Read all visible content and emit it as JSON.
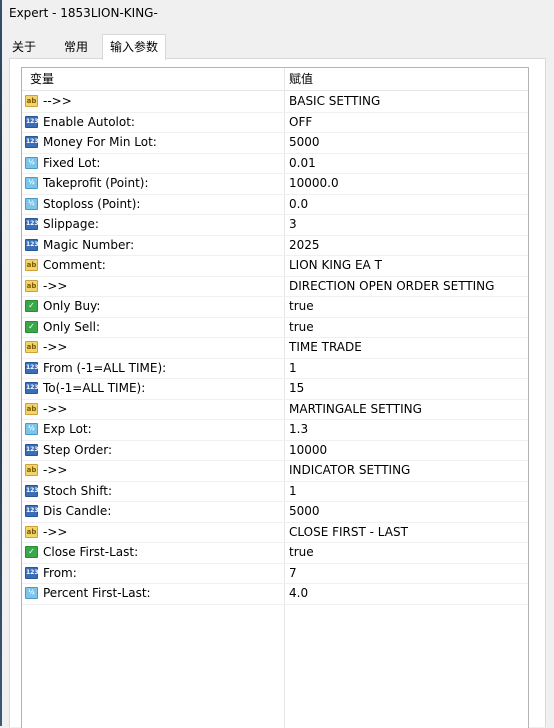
{
  "window": {
    "title": "Expert - 1853LION-KING-"
  },
  "tabs": [
    {
      "label": "关于"
    },
    {
      "label": "常用"
    },
    {
      "label": "输入参数"
    }
  ],
  "table": {
    "headers": {
      "variable": "变量",
      "value": "赋值"
    },
    "rows": [
      {
        "icon": "ab",
        "name": "-->>",
        "value": "BASIC SETTING"
      },
      {
        "icon": "123",
        "name": "Enable Autolot:",
        "value": "OFF"
      },
      {
        "icon": "123",
        "name": "Money For Min Lot:",
        "value": "5000"
      },
      {
        "icon": "1/2",
        "name": "Fixed Lot:",
        "value": "0.01"
      },
      {
        "icon": "1/2",
        "name": "Takeprofit (Point):",
        "value": "10000.0"
      },
      {
        "icon": "1/2",
        "name": "Stoploss (Point):",
        "value": "0.0"
      },
      {
        "icon": "123",
        "name": "Slippage:",
        "value": "3"
      },
      {
        "icon": "123",
        "name": "Magic Number:",
        "value": "2025"
      },
      {
        "icon": "ab",
        "name": "Comment:",
        "value": "LION KING EA T"
      },
      {
        "icon": "ab",
        "name": "->>",
        "value": "DIRECTION OPEN ORDER SETTING"
      },
      {
        "icon": "check",
        "name": "Only Buy:",
        "value": "true"
      },
      {
        "icon": "check",
        "name": "Only Sell:",
        "value": "true"
      },
      {
        "icon": "ab",
        "name": "->>",
        "value": "TIME TRADE"
      },
      {
        "icon": "123",
        "name": "From (-1=ALL TIME):",
        "value": "1"
      },
      {
        "icon": "123",
        "name": "To(-1=ALL TIME):",
        "value": "15"
      },
      {
        "icon": "ab",
        "name": "->>",
        "value": "MARTINGALE SETTING"
      },
      {
        "icon": "1/2",
        "name": "Exp Lot:",
        "value": "1.3"
      },
      {
        "icon": "123",
        "name": "Step Order:",
        "value": "10000"
      },
      {
        "icon": "ab",
        "name": "->>",
        "value": "INDICATOR SETTING"
      },
      {
        "icon": "123",
        "name": "Stoch Shift:",
        "value": "1"
      },
      {
        "icon": "123",
        "name": "Dis Candle:",
        "value": "5000"
      },
      {
        "icon": "ab",
        "name": "->>",
        "value": "CLOSE FIRST - LAST"
      },
      {
        "icon": "check",
        "name": "Close First-Last:",
        "value": "true"
      },
      {
        "icon": "123",
        "name": "From:",
        "value": "7"
      },
      {
        "icon": "1/2",
        "name": "Percent First-Last:",
        "value": "4.0"
      }
    ]
  }
}
